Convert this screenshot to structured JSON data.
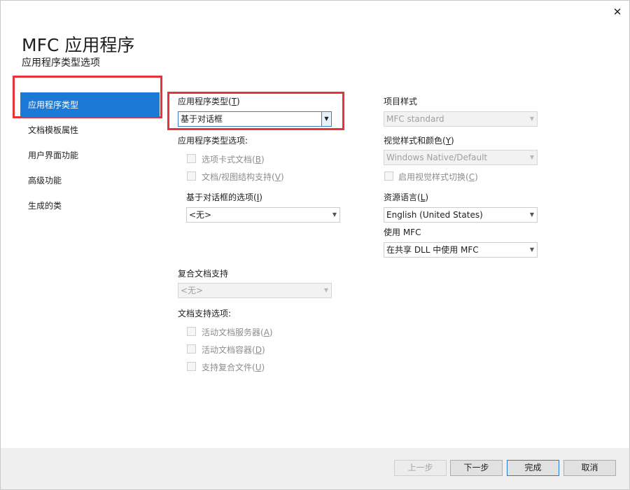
{
  "window": {
    "title": "MFC 应用程序",
    "subtitle": "应用程序类型选项",
    "close_icon": "✕"
  },
  "sidebar": {
    "items": [
      {
        "label": "应用程序类型",
        "active": true
      },
      {
        "label": "文档模板属性",
        "active": false
      },
      {
        "label": "用户界面功能",
        "active": false
      },
      {
        "label": "高级功能",
        "active": false
      },
      {
        "label": "生成的类",
        "active": false
      }
    ]
  },
  "left_column": {
    "app_type_label": "应用程序类型",
    "app_type_mnemonic": "T",
    "app_type_value": "基于对话框",
    "app_type_options_label": "应用程序类型选项:",
    "tabbed_docs_label": "选项卡式文档",
    "tabbed_docs_mnemonic": "B",
    "docview_label": "文档/视图结构支持",
    "docview_mnemonic": "V",
    "dialog_options_label": "基于对话框的选项",
    "dialog_options_mnemonic": "I",
    "dialog_options_value": "<无>",
    "compound_doc_label": "复合文档支持",
    "compound_doc_value": "<无>",
    "doc_support_label": "文档支持选项:",
    "active_server_label": "活动文档服务器",
    "active_server_mnemonic": "A",
    "active_container_label": "活动文档容器",
    "active_container_mnemonic": "D",
    "compound_files_label": "支持复合文件",
    "compound_files_mnemonic": "U"
  },
  "right_column": {
    "project_style_label": "项目样式",
    "project_style_value": "MFC standard",
    "visual_style_label": "视觉样式和颜色",
    "visual_style_mnemonic": "Y",
    "visual_style_value": "Windows Native/Default",
    "enable_switch_label": "启用视觉样式切换",
    "enable_switch_mnemonic": "C",
    "resource_lang_label": "资源语言",
    "resource_lang_mnemonic": "L",
    "resource_lang_value": "English (United States)",
    "use_mfc_label": "使用 MFC",
    "use_mfc_value": "在共享 DLL 中使用 MFC"
  },
  "footer": {
    "prev_label": "上一步",
    "next_label": "下一步",
    "finish_label": "完成",
    "cancel_label": "取消"
  },
  "icons": {
    "dropdown_arrow": "▼"
  },
  "colors": {
    "accent": "#1c7ad6",
    "highlight_box": "#e8333a"
  }
}
